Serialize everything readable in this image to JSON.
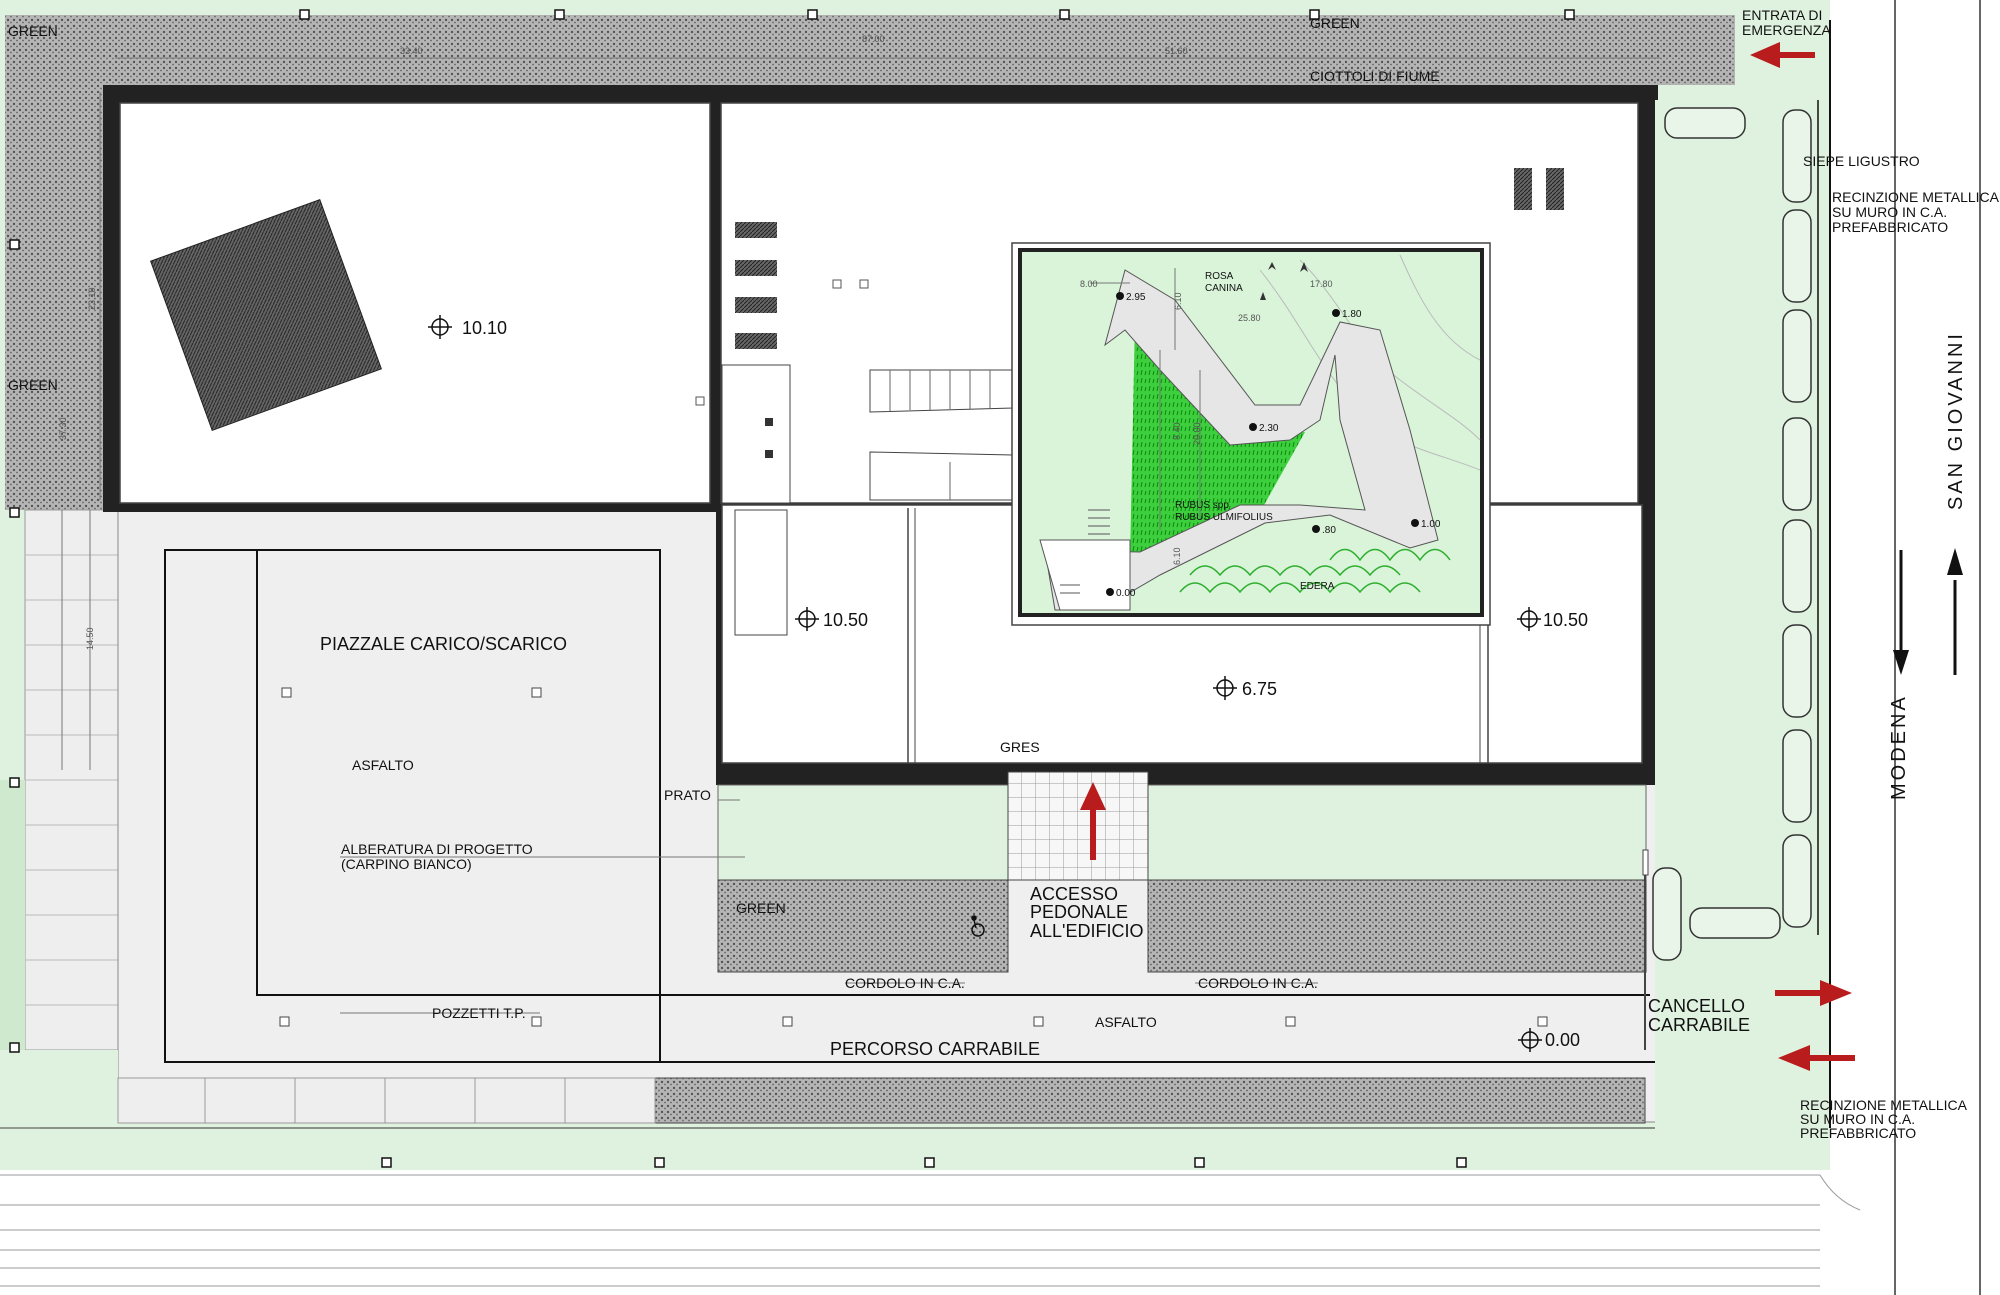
{
  "colors": {
    "lawn": "#dff2df",
    "gravel": "#9a9a9a",
    "paving": "#ececec",
    "building_wall": "#222222",
    "garden": "#35d035",
    "arrow": "#b81c1c"
  },
  "plan_labels": {
    "green_top_left": "GREEN",
    "green_top_right": "GREEN",
    "green_left": "GREEN",
    "green_bottom": "GREEN",
    "entrata_emergenza_1": "ENTRATA DI",
    "entrata_emergenza_2": "EMERGENZA",
    "ciottoli": "CIOTTOLI DI FIUME",
    "siepe": "SIEPE LIGUSTRO",
    "recinzione_top_1": "RECINZIONE METALLICA",
    "recinzione_top_2": "SU MURO IN C.A.",
    "recinzione_top_3": "PREFABBRICATO",
    "recinzione_bottom_1": "RECINZIONE METALLICA",
    "recinzione_bottom_2": "SU MURO IN C.A.",
    "recinzione_bottom_3": "PREFABBRICATO",
    "street_1": "SAN GIOVANNI",
    "street_2": "MODENA",
    "piazzale": "PIAZZALE CARICO/SCARICO",
    "asfalto_piazzale": "ASFALTO",
    "asfalto_road": "ASFALTO",
    "prato": "PRATO",
    "alberatura_1": "ALBERATURA DI PROGETTO",
    "alberatura_2": "(CARPINO BIANCO)",
    "gres": "GRES",
    "accesso_1": "ACCESSO",
    "accesso_2": "PEDONALE",
    "accesso_3": "ALL'EDIFICIO",
    "cordolo_1": "CORDOLO IN C.A.",
    "cordolo_2": "CORDOLO IN C.A.",
    "pozzetti": "POZZETTI T.P.",
    "percorso": "PERCORSO CARRABILE",
    "cancello_1": "CANCELLO",
    "cancello_2": "CARRABILE",
    "rosa_1": "ROSA",
    "rosa_2": "CANINA",
    "rubus_1": "RUBUS spp",
    "rubus_2": "RUBUS ULMIFOLIUS",
    "edera": "EDERA"
  },
  "elevations": {
    "roof_left": "10.10",
    "roof_center": "10.50",
    "roof_right": "10.50",
    "court": "6.75",
    "street": "0.00",
    "garden_a": "2.95",
    "garden_b": "1.80",
    "garden_c": "2.30",
    "garden_d": "1.00",
    "garden_e": ".80",
    "garden_f": "0.00"
  },
  "dimensions": {
    "top_1": "33.40",
    "top_2": "87.00",
    "top_3": "51.60",
    "left_1": "23.10",
    "left_2": "37.30",
    "lot": "14.50",
    "garden_1": "8.00",
    "garden_2": "17.80",
    "garden_3": "25.80",
    "garden_4": "6.10",
    "garden_5": "8.40",
    "garden_6": "20.00",
    "garden_7": "6.10"
  }
}
